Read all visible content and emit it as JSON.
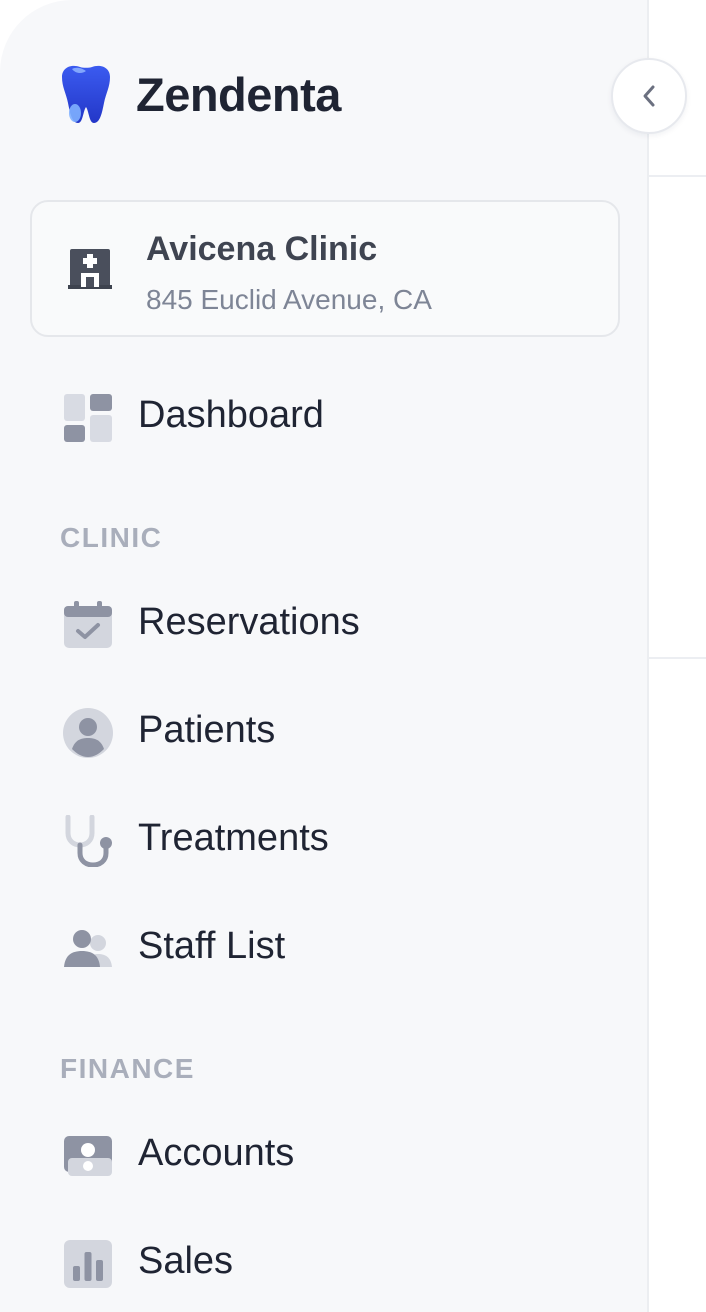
{
  "brand": {
    "name": "Zendenta",
    "logo_icon": "tooth-logo-icon",
    "accent_color": "#2f44e0"
  },
  "sidebar_toggle": {
    "icon": "chevron-left-icon"
  },
  "clinic": {
    "name": "Avicena Clinic",
    "address": "845 Euclid Avenue, CA",
    "icon": "hospital-icon"
  },
  "nav": {
    "dashboard": {
      "label": "Dashboard",
      "icon": "dashboard-icon"
    },
    "sections": {
      "clinic": "CLINIC",
      "finance": "FINANCE"
    },
    "clinic_items": [
      {
        "label": "Reservations",
        "icon": "calendar-check-icon"
      },
      {
        "label": "Patients",
        "icon": "user-icon"
      },
      {
        "label": "Treatments",
        "icon": "stethoscope-icon"
      },
      {
        "label": "Staff List",
        "icon": "users-icon"
      }
    ],
    "finance_items": [
      {
        "label": "Accounts",
        "icon": "wallet-icon"
      },
      {
        "label": "Sales",
        "icon": "bar-chart-icon"
      }
    ]
  },
  "colors": {
    "sidebar_bg": "#f7f8fa",
    "text_primary": "#1f2433",
    "text_muted": "#7e8596",
    "icon_gray": "#8e93a3",
    "icon_light": "#d3d6de"
  }
}
